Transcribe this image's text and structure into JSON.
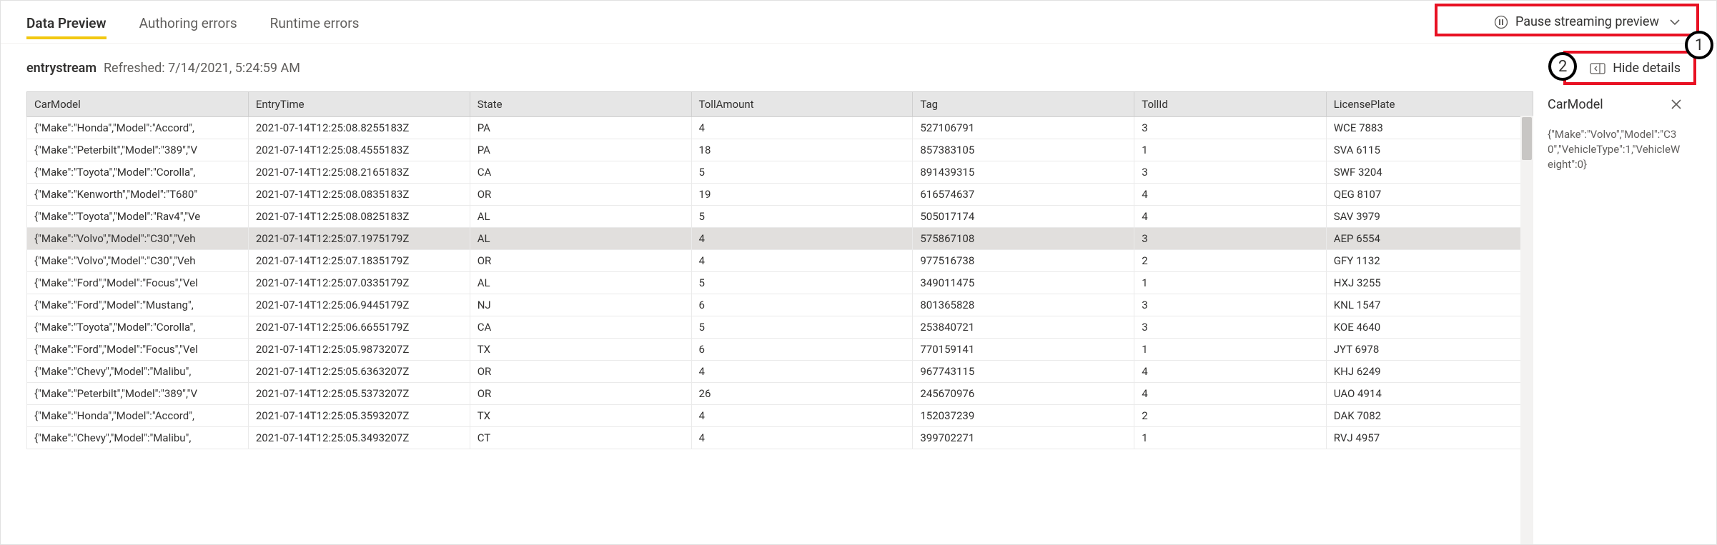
{
  "tabs": {
    "data_preview": "Data Preview",
    "authoring_errors": "Authoring errors",
    "runtime_errors": "Runtime errors"
  },
  "actions": {
    "pause_label": "Pause streaming preview",
    "hide_details_label": "Hide details"
  },
  "callouts": {
    "one": "1",
    "two": "2"
  },
  "stream": {
    "name": "entrystream",
    "refreshed_text": "Refreshed: 7/14/2021, 5:24:59 AM"
  },
  "details": {
    "title": "CarModel",
    "body": "{\"Make\":\"Volvo\",\"Model\":\"C30\",\"VehicleType\":1,\"VehicleWeight\":0}"
  },
  "columns": {
    "carmodel": "CarModel",
    "entrytime": "EntryTime",
    "state": "State",
    "tollamount": "TollAmount",
    "tag": "Tag",
    "tollid": "TollId",
    "licenseplate": "LicensePlate"
  },
  "selected_row_index": 5,
  "rows": [
    {
      "carmodel": "{\"Make\":\"Honda\",\"Model\":\"Accord\",",
      "entrytime": "2021-07-14T12:25:08.8255183Z",
      "state": "PA",
      "tollamount": "4",
      "tag": "527106791",
      "tollid": "3",
      "plate": "WCE 7883"
    },
    {
      "carmodel": "{\"Make\":\"Peterbilt\",\"Model\":\"389\",\"V",
      "entrytime": "2021-07-14T12:25:08.4555183Z",
      "state": "PA",
      "tollamount": "18",
      "tag": "857383105",
      "tollid": "1",
      "plate": "SVA 6115"
    },
    {
      "carmodel": "{\"Make\":\"Toyota\",\"Model\":\"Corolla\",",
      "entrytime": "2021-07-14T12:25:08.2165183Z",
      "state": "CA",
      "tollamount": "5",
      "tag": "891439315",
      "tollid": "3",
      "plate": "SWF 3204"
    },
    {
      "carmodel": "{\"Make\":\"Kenworth\",\"Model\":\"T680\"",
      "entrytime": "2021-07-14T12:25:08.0835183Z",
      "state": "OR",
      "tollamount": "19",
      "tag": "616574637",
      "tollid": "4",
      "plate": "QEG 8107"
    },
    {
      "carmodel": "{\"Make\":\"Toyota\",\"Model\":\"Rav4\",\"Ve",
      "entrytime": "2021-07-14T12:25:08.0825183Z",
      "state": "AL",
      "tollamount": "5",
      "tag": "505017174",
      "tollid": "4",
      "plate": "SAV 3979"
    },
    {
      "carmodel": "{\"Make\":\"Volvo\",\"Model\":\"C30\",\"Veh",
      "entrytime": "2021-07-14T12:25:07.1975179Z",
      "state": "AL",
      "tollamount": "4",
      "tag": "575867108",
      "tollid": "3",
      "plate": "AEP 6554"
    },
    {
      "carmodel": "{\"Make\":\"Volvo\",\"Model\":\"C30\",\"Veh",
      "entrytime": "2021-07-14T12:25:07.1835179Z",
      "state": "OR",
      "tollamount": "4",
      "tag": "977516738",
      "tollid": "2",
      "plate": "GFY 1132"
    },
    {
      "carmodel": "{\"Make\":\"Ford\",\"Model\":\"Focus\",\"Vel",
      "entrytime": "2021-07-14T12:25:07.0335179Z",
      "state": "AL",
      "tollamount": "5",
      "tag": "349011475",
      "tollid": "1",
      "plate": "HXJ 3255"
    },
    {
      "carmodel": "{\"Make\":\"Ford\",\"Model\":\"Mustang\",",
      "entrytime": "2021-07-14T12:25:06.9445179Z",
      "state": "NJ",
      "tollamount": "6",
      "tag": "801365828",
      "tollid": "3",
      "plate": "KNL 1547"
    },
    {
      "carmodel": "{\"Make\":\"Toyota\",\"Model\":\"Corolla\",",
      "entrytime": "2021-07-14T12:25:06.6655179Z",
      "state": "CA",
      "tollamount": "5",
      "tag": "253840721",
      "tollid": "3",
      "plate": "KOE 4640"
    },
    {
      "carmodel": "{\"Make\":\"Ford\",\"Model\":\"Focus\",\"Vel",
      "entrytime": "2021-07-14T12:25:05.9873207Z",
      "state": "TX",
      "tollamount": "6",
      "tag": "770159141",
      "tollid": "1",
      "plate": "JYT 6978"
    },
    {
      "carmodel": "{\"Make\":\"Chevy\",\"Model\":\"Malibu\",",
      "entrytime": "2021-07-14T12:25:05.6363207Z",
      "state": "OR",
      "tollamount": "4",
      "tag": "967743115",
      "tollid": "4",
      "plate": "KHJ 6249"
    },
    {
      "carmodel": "{\"Make\":\"Peterbilt\",\"Model\":\"389\",\"V",
      "entrytime": "2021-07-14T12:25:05.5373207Z",
      "state": "OR",
      "tollamount": "26",
      "tag": "245670976",
      "tollid": "4",
      "plate": "UAO 4914"
    },
    {
      "carmodel": "{\"Make\":\"Honda\",\"Model\":\"Accord\",",
      "entrytime": "2021-07-14T12:25:05.3593207Z",
      "state": "TX",
      "tollamount": "4",
      "tag": "152037239",
      "tollid": "2",
      "plate": "DAK 7082"
    },
    {
      "carmodel": "{\"Make\":\"Chevy\",\"Model\":\"Malibu\",",
      "entrytime": "2021-07-14T12:25:05.3493207Z",
      "state": "CT",
      "tollamount": "4",
      "tag": "399702271",
      "tollid": "1",
      "plate": "RVJ 4957"
    }
  ]
}
